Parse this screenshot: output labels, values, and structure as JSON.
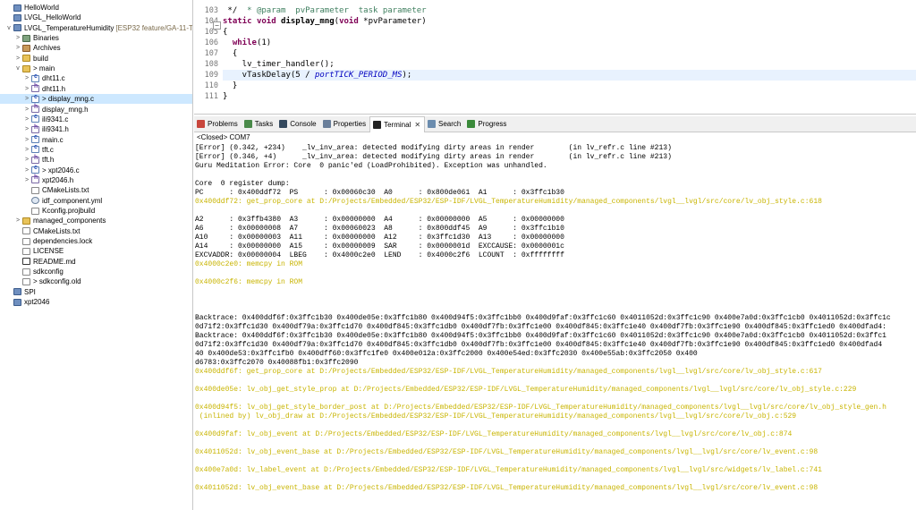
{
  "explorer": {
    "items": [
      {
        "label": "HelloWorld",
        "icon": "project-icon",
        "type": "project",
        "twisty": ""
      },
      {
        "label": "LVGL_HelloWorld",
        "icon": "project-icon",
        "type": "project",
        "twisty": ""
      },
      {
        "label": "LVGL_TemperatureHumidity",
        "decoration": "[ESP32 feature/GA-11-Tem",
        "icon": "project-icon",
        "type": "project",
        "twisty": "v"
      },
      {
        "label": "Binaries",
        "icon": "binaries-icon",
        "type": "binaries",
        "twisty": ">"
      },
      {
        "label": "Archives",
        "icon": "archives-icon",
        "type": "archives",
        "twisty": ">"
      },
      {
        "label": "build",
        "icon": "folder-icon",
        "type": "folder",
        "twisty": ">"
      },
      {
        "label": "> main",
        "icon": "folder-icon",
        "type": "folder",
        "twisty": "v"
      },
      {
        "label": "dht11.c",
        "icon": "c-file-icon",
        "type": "file-c",
        "twisty": ">"
      },
      {
        "label": "dht11.h",
        "icon": "h-file-icon",
        "type": "file-h",
        "twisty": ">"
      },
      {
        "label": "> display_mng.c",
        "icon": "c-file-icon",
        "type": "file-c",
        "twisty": ">",
        "selected": true
      },
      {
        "label": "display_mng.h",
        "icon": "h-file-icon",
        "type": "file-h",
        "twisty": ">"
      },
      {
        "label": "ili9341.c",
        "icon": "c-file-icon",
        "type": "file-c",
        "twisty": ">"
      },
      {
        "label": "ili9341.h",
        "icon": "h-file-icon",
        "type": "file-h",
        "twisty": ">"
      },
      {
        "label": "main.c",
        "icon": "c-file-icon",
        "type": "file-c",
        "twisty": ">"
      },
      {
        "label": "tft.c",
        "icon": "c-file-icon",
        "type": "file-c",
        "twisty": ">"
      },
      {
        "label": "tft.h",
        "icon": "h-file-icon",
        "type": "file-h",
        "twisty": ">"
      },
      {
        "label": "> xpt2046.c",
        "icon": "c-file-icon",
        "type": "file-c",
        "twisty": ">"
      },
      {
        "label": "xpt2046.h",
        "icon": "h-file-icon",
        "type": "file-h",
        "twisty": ">"
      },
      {
        "label": "CMakeLists.txt",
        "icon": "text-file-icon",
        "type": "file-txt",
        "twisty": ""
      },
      {
        "label": "idf_component.yml",
        "icon": "config-file-icon",
        "type": "file-gear",
        "twisty": ""
      },
      {
        "label": "Kconfig.projbuild",
        "icon": "text-file-icon",
        "type": "file-txt",
        "twisty": ""
      },
      {
        "label": "managed_components",
        "icon": "folder-icon",
        "type": "folder",
        "twisty": ">"
      },
      {
        "label": "CMakeLists.txt",
        "icon": "text-file-icon",
        "type": "file-txt",
        "twisty": ""
      },
      {
        "label": "dependencies.lock",
        "icon": "text-file-icon",
        "type": "file-txt",
        "twisty": ""
      },
      {
        "label": "LICENSE",
        "icon": "text-file-icon",
        "type": "file-txt",
        "twisty": ""
      },
      {
        "label": "README.md",
        "icon": "markdown-file-icon",
        "type": "file-md",
        "twisty": ""
      },
      {
        "label": "sdkconfig",
        "icon": "text-file-icon",
        "type": "file-txt",
        "twisty": ""
      },
      {
        "label": "> sdkconfig.old",
        "icon": "text-file-icon",
        "type": "file-txt",
        "twisty": ""
      },
      {
        "label": "SPI",
        "icon": "project-icon",
        "type": "project",
        "twisty": ""
      },
      {
        "label": "xpt2046",
        "icon": "project-icon",
        "type": "project",
        "twisty": ""
      }
    ]
  },
  "editor": {
    "lines": [
      {
        "num": "103",
        "text": " */"
      },
      {
        "num": "104",
        "text": "static void display_mng(void *pvParameter)"
      },
      {
        "num": "105",
        "text": "{"
      },
      {
        "num": "106",
        "text": "  while(1)"
      },
      {
        "num": "107",
        "text": "  {"
      },
      {
        "num": "108",
        "text": "    lv_timer_handler();"
      },
      {
        "num": "109",
        "text": "    vTaskDelay(5 / portTICK_PERIOD_MS);"
      },
      {
        "num": "110",
        "text": "  }"
      },
      {
        "num": "111",
        "text": "}"
      }
    ],
    "partial_top_line": " * @param  pvParameter  task parameter",
    "fold_marker": "−"
  },
  "views": {
    "tabs": [
      {
        "label": "Problems",
        "icon": "problems-icon",
        "color": "#c8463c"
      },
      {
        "label": "Tasks",
        "icon": "tasks-icon",
        "color": "#4a8a4a"
      },
      {
        "label": "Console",
        "icon": "console-icon",
        "color": "#34495e"
      },
      {
        "label": "Properties",
        "icon": "properties-icon",
        "color": "#6a7f9a"
      },
      {
        "label": "Terminal",
        "icon": "terminal-icon",
        "color": "#222222",
        "active": true,
        "close": "✕"
      },
      {
        "label": "Search",
        "icon": "search-icon",
        "color": "#6b8cae"
      },
      {
        "label": "Progress",
        "icon": "progress-icon",
        "color": "#3a8a3a"
      }
    ]
  },
  "console": {
    "title": "<Closed> COM7",
    "lines": [
      {
        "text": "[Error] (0.342, +234)    _lv_inv_area: detected modifying dirty areas in render        (in lv_refr.c line #213)",
        "color": "black"
      },
      {
        "text": "[Error] (0.346, +4)      _lv_inv_area: detected modifying dirty areas in render        (in lv_refr.c line #213)",
        "color": "black"
      },
      {
        "text": "Guru Meditation Error: Core  0 panic'ed (LoadProhibited). Exception was unhandled.",
        "color": "black"
      },
      {
        "text": "",
        "color": "black"
      },
      {
        "text": "Core  0 register dump:",
        "color": "black"
      },
      {
        "text": "PC      : 0x400ddf72  PS      : 0x00060c30  A0      : 0x800de061  A1      : 0x3ffc1b30",
        "color": "black"
      },
      {
        "text": "0x400ddf72: get_prop_core at D:/Projects/Embedded/ESP32/ESP-IDF/LVGL_TemperatureHumidity/managed_components/lvgl__lvgl/src/core/lv_obj_style.c:618",
        "color": "yellow"
      },
      {
        "text": "",
        "color": "black"
      },
      {
        "text": "A2      : 0x3ffb4380  A3      : 0x00000000  A4      : 0x00000000  A5      : 0x00000000",
        "color": "black"
      },
      {
        "text": "A6      : 0x00000008  A7      : 0x00060023  A8      : 0x800ddf45  A9      : 0x3ffc1b10",
        "color": "black"
      },
      {
        "text": "A10     : 0x00000003  A11     : 0x00000000  A12     : 0x3ffc1d30  A13     : 0x00000000",
        "color": "black"
      },
      {
        "text": "A14     : 0x00000000  A15     : 0x00000009  SAR     : 0x0000001d  EXCCAUSE: 0x0000001c",
        "color": "black"
      },
      {
        "text": "EXCVADDR: 0x00000004  LBEG    : 0x4000c2e0  LEND    : 0x4000c2f6  LCOUNT  : 0xffffffff",
        "color": "black"
      },
      {
        "text": "0x4000c2e0: memcpy in ROM",
        "color": "yellow"
      },
      {
        "text": "",
        "color": "black"
      },
      {
        "text": "0x4000c2f6: memcpy in ROM",
        "color": "yellow"
      },
      {
        "text": "",
        "color": "black"
      },
      {
        "text": "",
        "color": "black"
      },
      {
        "text": "",
        "color": "black"
      },
      {
        "text": "Backtrace: 0x400ddf6f:0x3ffc1b30 0x400de05e:0x3ffc1b80 0x400d94f5:0x3ffc1bb0 0x400d9faf:0x3ffc1c60 0x4011052d:0x3ffc1c90 0x400e7a0d:0x3ffc1cb0 0x4011052d:0x3ffc1c",
        "color": "black"
      },
      {
        "text": "0d71f2:0x3ffc1d30 0x400df79a:0x3ffc1d70 0x400df845:0x3ffc1db0 0x400df7fb:0x3ffc1e00 0x400df845:0x3ffc1e40 0x400df7fb:0x3ffc1e90 0x400df845:0x3ffc1ed0 0x400dfad4:",
        "color": "black"
      },
      {
        "text": "Backtrace: 0x400ddf6f:0x3ffc1b30 0x400de05e:0x3ffc1b80 0x400d94f5:0x3ffc1bb0 0x400d9faf:0x3ffc1c60 0x4011052d:0x3ffc1c90 0x400e7a0d:0x3ffc1cb0 0x4011052d:0x3ffc1",
        "color": "black"
      },
      {
        "text": "0d71f2:0x3ffc1d30 0x400df79a:0x3ffc1d70 0x400df845:0x3ffc1db0 0x400df7fb:0x3ffc1e00 0x400df845:0x3ffc1e40 0x400df7fb:0x3ffc1e90 0x400df845:0x3ffc1ed0 0x400dfad4",
        "color": "black"
      },
      {
        "text": "40 0x400de53:0x3ffc1fb0 0x400dff60:0x3ffc1fe0 0x400e012a:0x3ffc2000 0x400e54ed:0x3ffc2030 0x400e55ab:0x3ffc2050 0x400",
        "color": "black"
      },
      {
        "text": "d6783:0x3ffc2070 0x40088fb1:0x3ffc2090",
        "color": "black"
      },
      {
        "text": "0x400ddf6f: get_prop_core at D:/Projects/Embedded/ESP32/ESP-IDF/LVGL_TemperatureHumidity/managed_components/lvgl__lvgl/src/core/lv_obj_style.c:617",
        "color": "yellow"
      },
      {
        "text": "",
        "color": "black"
      },
      {
        "text": "0x400de05e: lv_obj_get_style_prop at D:/Projects/Embedded/ESP32/ESP-IDF/LVGL_TemperatureHumidity/managed_components/lvgl__lvgl/src/core/lv_obj_style.c:229",
        "color": "yellow"
      },
      {
        "text": "",
        "color": "black"
      },
      {
        "text": "0x400d94f5: lv_obj_get_style_border_post at D:/Projects/Embedded/ESP32/ESP-IDF/LVGL_TemperatureHumidity/managed_components/lvgl__lvgl/src/core/lv_obj_style_gen.h",
        "color": "yellow"
      },
      {
        "text": " (inlined by) lv_obj_draw at D:/Projects/Embedded/ESP32/ESP-IDF/LVGL_TemperatureHumidity/managed_components/lvgl__lvgl/src/core/lv_obj.c:529",
        "color": "yellow"
      },
      {
        "text": "",
        "color": "black"
      },
      {
        "text": "0x400d9faf: lv_obj_event at D:/Projects/Embedded/ESP32/ESP-IDF/LVGL_TemperatureHumidity/managed_components/lvgl__lvgl/src/core/lv_obj.c:874",
        "color": "yellow"
      },
      {
        "text": "",
        "color": "black"
      },
      {
        "text": "0x4011052d: lv_obj_event_base at D:/Projects/Embedded/ESP32/ESP-IDF/LVGL_TemperatureHumidity/managed_components/lvgl__lvgl/src/core/lv_event.c:98",
        "color": "yellow"
      },
      {
        "text": "",
        "color": "black"
      },
      {
        "text": "0x400e7a0d: lv_label_event at D:/Projects/Embedded/ESP32/ESP-IDF/LVGL_TemperatureHumidity/managed_components/lvgl__lvgl/src/widgets/lv_label.c:741",
        "color": "yellow"
      },
      {
        "text": "",
        "color": "black"
      },
      {
        "text": "0x4011052d: lv_obj_event_base at D:/Projects/Embedded/ESP32/ESP-IDF/LVGL_TemperatureHumidity/managed_components/lvgl__lvgl/src/core/lv_event.c:98",
        "color": "yellow"
      }
    ]
  }
}
